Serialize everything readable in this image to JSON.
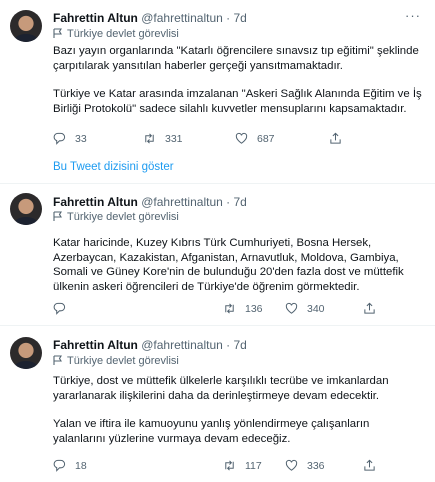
{
  "tweets": [
    {
      "name": "Fahrettin Altun",
      "handle": "@fahrettinaltun",
      "time": "7d",
      "label": "Türkiye devlet görevlisi",
      "paragraphs": [
        "Bazı yayın organlarında \"Katarlı öğrencilere sınavsız tıp eğitimi\" şeklinde çarpıtılarak yansıtılan haberler gerçeği yansıtmamaktadır.",
        "Türkiye ve Katar arasında imzalanan \"Askeri Sağlık Alanında Eğitim ve İş Birliği Protokolü\" sadece silahlı kuvvetler mensuplarını kapsamaktadır."
      ],
      "replies": "33",
      "retweets": "331",
      "likes": "687"
    },
    {
      "name": "Fahrettin Altun",
      "handle": "@fahrettinaltun",
      "time": "7d",
      "label": "Türkiye devlet görevlisi",
      "paragraphs": [
        "Katar haricinde, Kuzey Kıbrıs Türk Cumhuriyeti, Bosna Hersek, Azerbaycan, Kazakistan, Afganistan, Arnavutluk, Moldova, Gambiya, Somali ve Güney Kore'nin de bulunduğu 20'den fazla dost ve müttefik ülkenin askeri öğrencileri de Türkiye'de öğrenim görmektedir."
      ],
      "replies": "",
      "retweets": "136",
      "likes": "340"
    },
    {
      "name": "Fahrettin Altun",
      "handle": "@fahrettinaltun",
      "time": "7d",
      "label": "Türkiye devlet görevlisi",
      "paragraphs": [
        "Türkiye, dost ve müttefik ülkelerle karşılıklı tecrübe ve imkanlardan yararlanarak ilişkilerini daha da derinleştirmeye devam edecektir.",
        "Yalan ve iftira ile kamuoyunu yanlış yönlendirmeye çalışanların yalanlarını yüzlerine vurmaya devam edeceğiz."
      ],
      "replies": "18",
      "retweets": "117",
      "likes": "336"
    }
  ],
  "thread_link": "Bu Tweet dizisini göster",
  "separator_dot": "·",
  "colors": {
    "link": "#1d9bf0",
    "muted": "#536471",
    "text": "#0f1419",
    "border": "#eff3f4"
  },
  "icons": {
    "reply": "reply-icon",
    "retweet": "retweet-icon",
    "like": "heart-icon",
    "share": "share-icon",
    "label": "flag-icon",
    "more": "more-icon"
  }
}
